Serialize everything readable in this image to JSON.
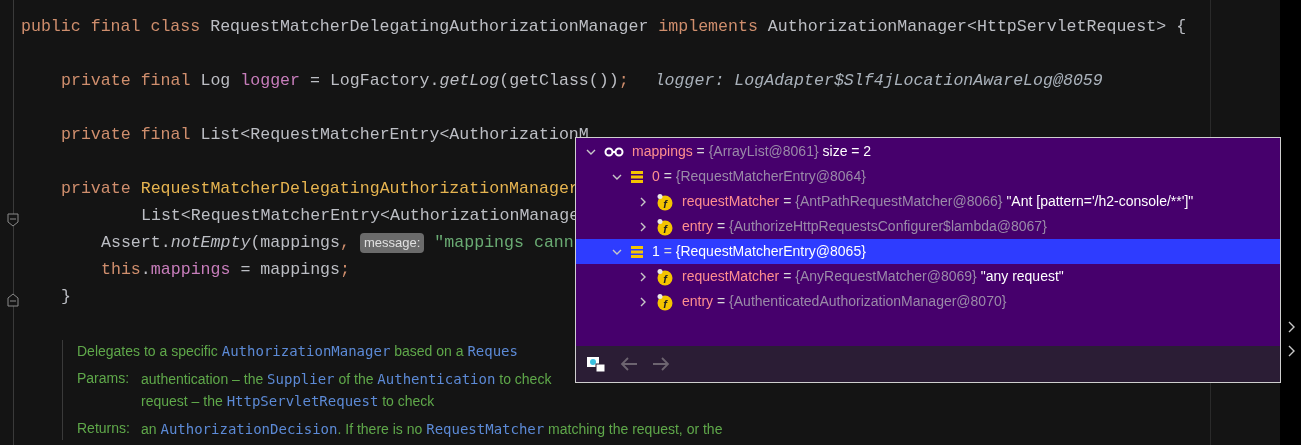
{
  "code_lines": [
    {
      "kind": "top",
      "segments": [
        {
          "kind": "keyword",
          "text": "public final class "
        },
        {
          "kind": "plain",
          "text": "RequestMatcherDelegatingAuthorizationManager "
        },
        {
          "kind": "keyword",
          "text": "implements "
        },
        {
          "kind": "plain",
          "text": "AuthorizationManager<HttpServletRequest> {"
        }
      ]
    },
    {
      "kind": "blank"
    },
    {
      "kind": "member",
      "segments": [
        {
          "kind": "keyword",
          "text": "private final "
        },
        {
          "kind": "plain",
          "text": "Log "
        },
        {
          "kind": "field",
          "text": "logger"
        },
        {
          "kind": "plain",
          "text": " = LogFactory."
        },
        {
          "kind": "italic",
          "text": "getLog"
        },
        {
          "kind": "plain",
          "text": "(getClass())"
        },
        {
          "kind": "keyword",
          "text": ";"
        },
        {
          "kind": "inline_value",
          "text": "logger: LogAdapter$Slf4jLocationAwareLog@8059"
        }
      ]
    },
    {
      "kind": "blank"
    },
    {
      "kind": "member",
      "segments": [
        {
          "kind": "keyword",
          "text": "private final "
        },
        {
          "kind": "plain",
          "text": "List<RequestMatcherEntry<AuthorizationM"
        }
      ]
    },
    {
      "kind": "blank"
    },
    {
      "kind": "member",
      "segments": [
        {
          "kind": "keyword",
          "text": "private "
        },
        {
          "kind": "declaration",
          "text": "RequestMatcherDelegatingAuthorizationManager"
        }
      ]
    },
    {
      "kind": "continuation",
      "segments": [
        {
          "kind": "plain",
          "text": "List<RequestMatcherEntry<AuthorizationManage"
        }
      ]
    },
    {
      "kind": "body",
      "segments": [
        {
          "kind": "plain",
          "text": "Assert."
        },
        {
          "kind": "italic",
          "text": "notEmpty"
        },
        {
          "kind": "plain",
          "text": "(mappings"
        },
        {
          "kind": "keyword",
          "text": ","
        },
        {
          "kind": "param_hint",
          "text": "message:"
        },
        {
          "kind": "string",
          "text": "\"mappings cann"
        }
      ]
    },
    {
      "kind": "body",
      "segments": [
        {
          "kind": "keyword",
          "text": "this"
        },
        {
          "kind": "plain",
          "text": "."
        },
        {
          "kind": "field",
          "text": "mappings"
        },
        {
          "kind": "plain",
          "text": " = mappings"
        },
        {
          "kind": "keyword",
          "text": ";"
        }
      ]
    },
    {
      "kind": "member",
      "segments": [
        {
          "kind": "plain",
          "text": "}"
        }
      ]
    }
  ],
  "doc": [
    {
      "lines": [
        [
          {
            "kind": "text",
            "text": "Delegates to a specific "
          },
          {
            "kind": "code",
            "text": "AuthorizationManager"
          },
          {
            "kind": "text",
            "text": " based on a "
          },
          {
            "kind": "code",
            "text": "Reques"
          }
        ]
      ]
    },
    {
      "label": "Params:",
      "lines": [
        [
          {
            "kind": "text",
            "text": "authentication – the "
          },
          {
            "kind": "code",
            "text": "Supplier"
          },
          {
            "kind": "text",
            "text": " of the "
          },
          {
            "kind": "code",
            "text": "Authentication"
          },
          {
            "kind": "text",
            "text": " to check"
          }
        ],
        [
          {
            "kind": "text",
            "text": "request – the "
          },
          {
            "kind": "code",
            "text": "HttpServletRequest"
          },
          {
            "kind": "text",
            "text": " to check"
          }
        ]
      ]
    },
    {
      "label": "Returns:",
      "lines": [
        [
          {
            "kind": "text",
            "text": "an "
          },
          {
            "kind": "code",
            "text": "AuthorizationDecision"
          },
          {
            "kind": "text",
            "text": ". If there is no "
          },
          {
            "kind": "code",
            "text": "RequestMatcher"
          },
          {
            "kind": "text",
            "text": " matching the request, or the"
          }
        ]
      ]
    }
  ],
  "variables": {
    "root": {
      "kind": "watch",
      "name": "mappings",
      "operator": "=",
      "value": "{ArrayList@8061}",
      "extra": "size = 2",
      "expanded": true,
      "selected": false,
      "children": [
        {
          "kind": "entry",
          "name": "0",
          "operator": "=",
          "value": "{RequestMatcherEntry@8064}",
          "expanded": true,
          "selected": false,
          "children": [
            {
              "kind": "field",
              "badge": "f",
              "name": "requestMatcher",
              "operator": "=",
              "value": "{AntPathRequestMatcher@8066}",
              "extra": "\"Ant [pattern='/h2-console/**']\"",
              "expanded": false,
              "selected": false
            },
            {
              "kind": "field",
              "badge": "f",
              "name": "entry",
              "operator": "=",
              "value": "{AuthorizeHttpRequestsConfigurer$lambda@8067}",
              "expanded": false,
              "selected": false
            }
          ]
        },
        {
          "kind": "entry",
          "name": "1",
          "operator": "=",
          "value": "{RequestMatcherEntry@8065}",
          "expanded": true,
          "selected": true,
          "children": [
            {
              "kind": "field",
              "badge": "f",
              "name": "requestMatcher",
              "operator": "=",
              "value": "{AnyRequestMatcher@8069}",
              "extra": "\"any request\"",
              "expanded": false,
              "selected": false
            },
            {
              "kind": "field",
              "badge": "f",
              "name": "entry",
              "operator": "=",
              "value": "{AuthenticatedAuthorizationManager@8070}",
              "expanded": false,
              "selected": false
            }
          ]
        }
      ]
    }
  },
  "toolbar": {
    "back_disabled": true,
    "forward_disabled": true
  }
}
